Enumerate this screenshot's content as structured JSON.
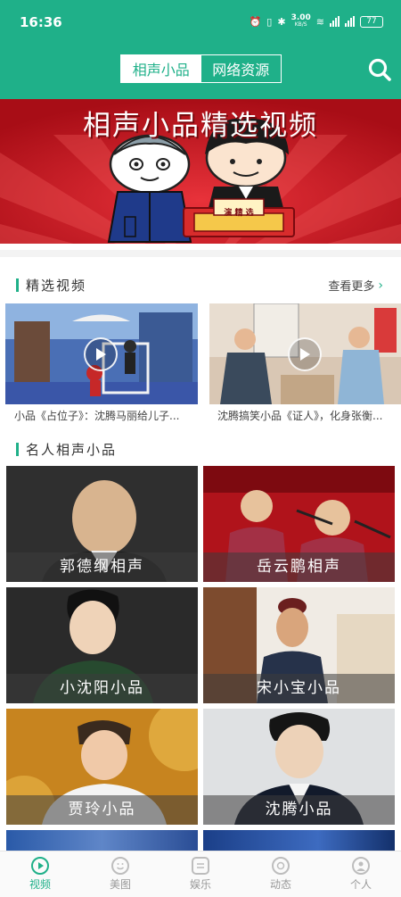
{
  "status": {
    "time": "16:36",
    "net_speed": "3.00",
    "net_unit": "KB/S",
    "battery": "77"
  },
  "header": {
    "tabs": [
      {
        "label": "相声小品"
      },
      {
        "label": "网络资源"
      }
    ]
  },
  "banner": {
    "title": "相声小品精选视频",
    "sign_text": "演 精 选"
  },
  "featured": {
    "title": "精选视频",
    "more": "查看更多",
    "videos": [
      {
        "caption": "小品《占位子》：沈腾马丽给儿子..."
      },
      {
        "caption": "沈腾搞笑小品《证人》，化身张衡..."
      }
    ]
  },
  "famous": {
    "title": "名人相声小品",
    "cards": [
      {
        "label": "郭德纲相声"
      },
      {
        "label": "岳云鹏相声"
      },
      {
        "label": "小沈阳小品"
      },
      {
        "label": "宋小宝小品"
      },
      {
        "label": "贾玲小品"
      },
      {
        "label": "沈腾小品"
      }
    ]
  },
  "nav": {
    "items": [
      {
        "label": "视频",
        "icon": "play-circle-icon"
      },
      {
        "label": "美图",
        "icon": "smile-icon"
      },
      {
        "label": "娱乐",
        "icon": "message-icon"
      },
      {
        "label": "动态",
        "icon": "aperture-icon"
      },
      {
        "label": "个人",
        "icon": "person-icon"
      }
    ]
  },
  "colors": {
    "accent": "#1fb089",
    "banner_red": "#c8121c"
  }
}
